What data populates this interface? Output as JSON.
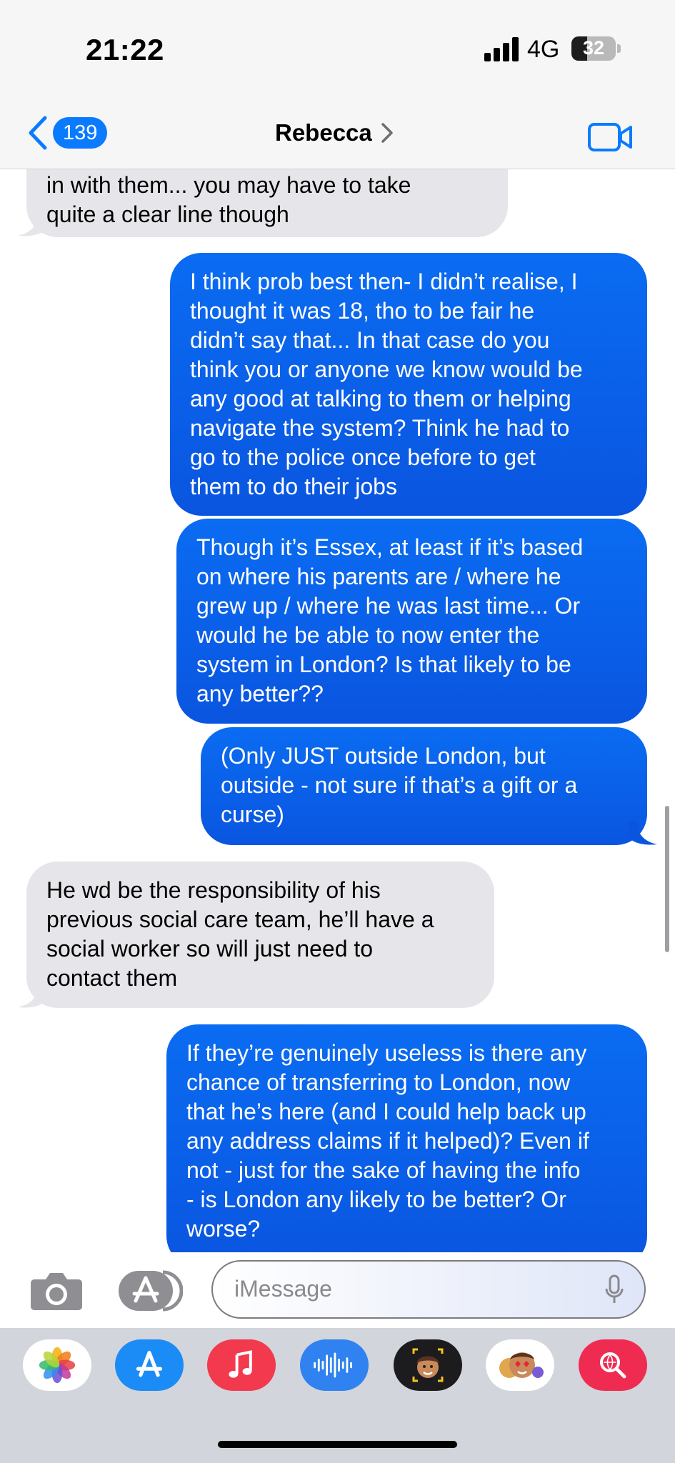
{
  "status_bar": {
    "time": "21:22",
    "network": "4G",
    "battery": "32"
  },
  "nav": {
    "back_count": "139",
    "contact_name": "Rebecca"
  },
  "messages": [
    {
      "direction": "incoming",
      "lines": [
        "in with them... you may have to take",
        "quite a clear line though"
      ]
    },
    {
      "direction": "outgoing",
      "lines": [
        "I think prob best then- I didn’t realise, I",
        "thought it was 18, tho to be fair he",
        "didn’t say that... In that case do you",
        "think you or anyone we know would be",
        "any good at talking to them or helping",
        "navigate the system? Think he had to",
        "go to the police once before to get",
        "them to do their jobs"
      ]
    },
    {
      "direction": "outgoing",
      "lines": [
        "Though it’s Essex, at least if it’s based",
        "on where his parents are / where he",
        "grew up / where he was last time... Or",
        "would he be able to now enter the",
        "system in London? Is that likely to be",
        "any better??"
      ]
    },
    {
      "direction": "outgoing",
      "lines": [
        "(Only JUST outside London, but",
        "outside - not sure if that’s a gift or a",
        "curse)"
      ]
    },
    {
      "direction": "incoming",
      "lines": [
        "He wd be the responsibility of his",
        "previous social care team, he’ll have a",
        "social worker so will just need to",
        "contact them"
      ]
    },
    {
      "direction": "outgoing",
      "lines": [
        "If they’re genuinely useless is there any",
        "chance of transferring to London, now",
        "that he’s here (and I could help back up",
        "any address claims if it helped)? Even if",
        "not - just for the sake of having the info",
        "- is London any likely to be better? Or",
        "worse?"
      ]
    }
  ],
  "input": {
    "placeholder": "iMessage"
  },
  "app_drawer": {
    "icons": [
      "photos-icon",
      "app-store-icon",
      "music-icon",
      "audio-message-icon",
      "memoji-icon",
      "memoji-stickers-icon",
      "web-search-icon"
    ]
  },
  "colors": {
    "outgoing_bubble": "#0a62ec",
    "incoming_bubble": "#e5e5ea",
    "accent": "#0a7bff"
  }
}
